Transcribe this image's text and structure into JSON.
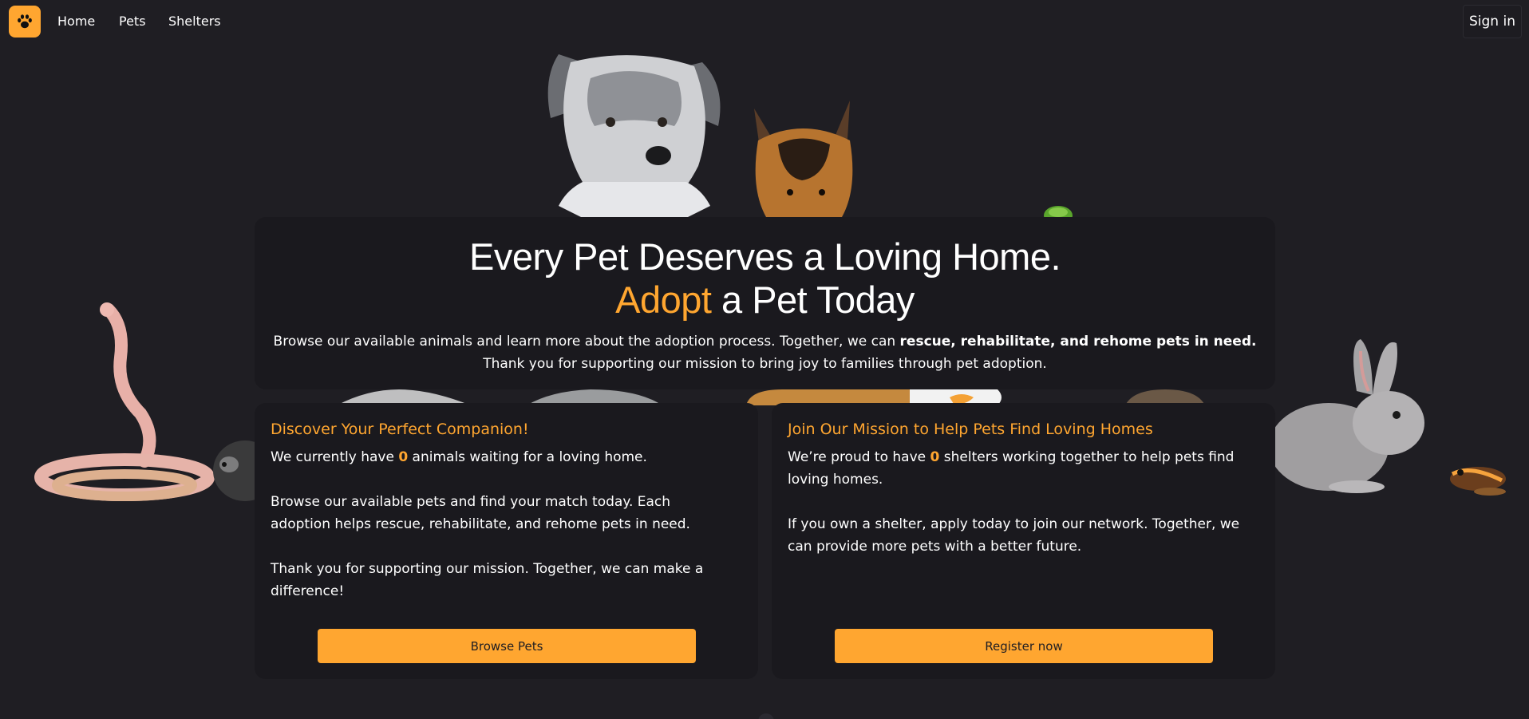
{
  "nav": {
    "logo_icon": "paw-icon",
    "links": [
      {
        "label": "Home"
      },
      {
        "label": "Pets"
      },
      {
        "label": "Shelters"
      }
    ],
    "signin_label": "Sign in"
  },
  "hero": {
    "title_line1": "Every Pet Deserves a Loving Home.",
    "title_line2_accent": "Adopt",
    "title_line2_rest": " a Pet Today",
    "desc_part1": "Browse our available animals and learn more about the adoption process. Together, we can ",
    "desc_bold": "rescue, rehabilitate, and rehome pets in need.",
    "desc_part2": " Thank you for supporting our mission to bring joy to families through pet adoption."
  },
  "cards": {
    "left": {
      "title": "Discover Your Perfect Companion!",
      "p1_before": "We currently have ",
      "p1_count": "0",
      "p1_after": " animals waiting for a loving home.",
      "p2": "Browse our available pets and find your match today. Each adoption helps rescue, rehabilitate, and rehome pets in need.",
      "p3": "Thank you for supporting our mission. Together, we can make a difference!",
      "button_label": "Browse Pets"
    },
    "right": {
      "title": "Join Our Mission to Help Pets Find Loving Homes",
      "p1_before": "We’re proud to have ",
      "p1_count": "0",
      "p1_after": " shelters working together to help pets find loving homes.",
      "p2": "If you own a shelter, apply today to join our network. Together, we can provide more pets with a better future.",
      "button_label": "Register now"
    }
  },
  "colors": {
    "accent": "#ffa630",
    "background": "#1f1e23",
    "card": "#1a191e"
  },
  "illustrations": [
    "dog-icon",
    "shepherd-dog-icon",
    "snake-icon",
    "guinea-pig-icon",
    "rabbit-icon",
    "frog-icon",
    "bird-icon"
  ]
}
